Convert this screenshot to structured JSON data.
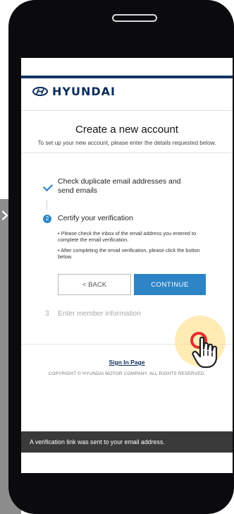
{
  "navigation": {
    "side_chevron": "›"
  },
  "brand": {
    "logo_text": "HYUNDAI"
  },
  "page": {
    "title": "Create a new account",
    "subtitle": "To set up your new account, please enter the details requested below."
  },
  "steps": {
    "step1": {
      "label": "Check duplicate email addresses and send emails",
      "status": "completed"
    },
    "step2": {
      "number": "2",
      "label": "Certify your verification",
      "bullets": [
        "Please check the inbox of the email address you entered to complete the email verification.",
        "After completing the email verification, please click the button below."
      ]
    },
    "step3": {
      "number": "3",
      "label": "Enter member information"
    }
  },
  "buttons": {
    "back": "< BACK",
    "continue": "CONTINUE"
  },
  "footer": {
    "sign_in": "Sign In Page",
    "copyright": "COPYRIGHT © HYUNDAI MOTOR COMPANY. ALL RIGHTS RESERVED."
  },
  "toast": {
    "message": "A verification link was sent to your email address."
  },
  "colors": {
    "brand_navy": "#0b2c5a",
    "accent_blue": "#2d84c6",
    "toast_bg": "#3a3a3a",
    "click_highlight": "#e52e2e"
  },
  "icons": {
    "check": "check-icon",
    "hand_pointer": "hand-pointer-icon",
    "side_chevron": "chevron-right-icon"
  }
}
